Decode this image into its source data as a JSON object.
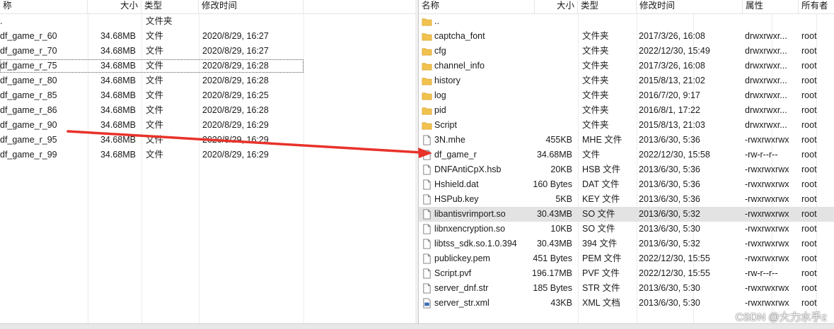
{
  "left": {
    "columns": {
      "name": "称",
      "size": "大小",
      "type": "类型",
      "modified": "修改时间"
    },
    "rows": [
      {
        "name": ".",
        "size": "",
        "type": "文件夹",
        "modified": ""
      },
      {
        "name": "df_game_r_60",
        "size": "34.68MB",
        "type": "文件",
        "modified": "2020/8/29, 16:27"
      },
      {
        "name": "df_game_r_70",
        "size": "34.68MB",
        "type": "文件",
        "modified": "2020/8/29, 16:27"
      },
      {
        "name": "df_game_r_75",
        "size": "34.68MB",
        "type": "文件",
        "modified": "2020/8/29, 16:28"
      },
      {
        "name": "df_game_r_80",
        "size": "34.68MB",
        "type": "文件",
        "modified": "2020/8/29, 16:28"
      },
      {
        "name": "df_game_r_85",
        "size": "34.68MB",
        "type": "文件",
        "modified": "2020/8/29, 16:25"
      },
      {
        "name": "df_game_r_86",
        "size": "34.68MB",
        "type": "文件",
        "modified": "2020/8/29, 16:28"
      },
      {
        "name": "df_game_r_90",
        "size": "34.68MB",
        "type": "文件",
        "modified": "2020/8/29, 16:29"
      },
      {
        "name": "df_game_r_95",
        "size": "34.68MB",
        "type": "文件",
        "modified": "2020/8/29, 16:29"
      },
      {
        "name": "df_game_r_99",
        "size": "34.68MB",
        "type": "文件",
        "modified": "2020/8/29, 16:29"
      }
    ]
  },
  "right": {
    "columns": {
      "name": "名称",
      "size": "大小",
      "type": "类型",
      "modified": "修改时间",
      "attrs": "属性",
      "owner": "所有者"
    },
    "rows": [
      {
        "icon": "folder-icon",
        "name": "..",
        "size": "",
        "type": "",
        "modified": "",
        "attrs": "",
        "owner": ""
      },
      {
        "icon": "folder-icon",
        "name": "captcha_font",
        "size": "",
        "type": "文件夹",
        "modified": "2017/3/26, 16:08",
        "attrs": "drwxrwxr...",
        "owner": "root"
      },
      {
        "icon": "folder-icon",
        "name": "cfg",
        "size": "",
        "type": "文件夹",
        "modified": "2022/12/30, 15:49",
        "attrs": "drwxrwxr...",
        "owner": "root"
      },
      {
        "icon": "folder-icon",
        "name": "channel_info",
        "size": "",
        "type": "文件夹",
        "modified": "2017/3/26, 16:08",
        "attrs": "drwxrwxr...",
        "owner": "root"
      },
      {
        "icon": "folder-icon",
        "name": "history",
        "size": "",
        "type": "文件夹",
        "modified": "2015/8/13, 21:02",
        "attrs": "drwxrwxr...",
        "owner": "root"
      },
      {
        "icon": "folder-icon",
        "name": "log",
        "size": "",
        "type": "文件夹",
        "modified": "2016/7/20, 9:17",
        "attrs": "drwxrwxr...",
        "owner": "root"
      },
      {
        "icon": "folder-icon",
        "name": "pid",
        "size": "",
        "type": "文件夹",
        "modified": "2016/8/1, 17:22",
        "attrs": "drwxrwxr...",
        "owner": "root"
      },
      {
        "icon": "folder-icon",
        "name": "Script",
        "size": "",
        "type": "文件夹",
        "modified": "2015/8/13, 21:03",
        "attrs": "drwxrwxr...",
        "owner": "root"
      },
      {
        "icon": "file-icon",
        "name": "3N.mhe",
        "size": "455KB",
        "type": "MHE 文件",
        "modified": "2013/6/30, 5:36",
        "attrs": "-rwxrwxrwx",
        "owner": "root"
      },
      {
        "icon": "file-icon",
        "name": "df_game_r",
        "size": "34.68MB",
        "type": "文件",
        "modified": "2022/12/30, 15:58",
        "attrs": "-rw-r--r--",
        "owner": "root"
      },
      {
        "icon": "file-icon",
        "name": "DNFAntiCpX.hsb",
        "size": "20KB",
        "type": "HSB 文件",
        "modified": "2013/6/30, 5:36",
        "attrs": "-rwxrwxrwx",
        "owner": "root"
      },
      {
        "icon": "file-icon",
        "name": "Hshield.dat",
        "size": "160 Bytes",
        "type": "DAT 文件",
        "modified": "2013/6/30, 5:36",
        "attrs": "-rwxrwxrwx",
        "owner": "root"
      },
      {
        "icon": "file-icon",
        "name": "HSPub.key",
        "size": "5KB",
        "type": "KEY 文件",
        "modified": "2013/6/30, 5:36",
        "attrs": "-rwxrwxrwx",
        "owner": "root"
      },
      {
        "icon": "file-icon",
        "name": "libantisvrimport.so",
        "size": "30.43MB",
        "type": "SO 文件",
        "modified": "2013/6/30, 5:32",
        "attrs": "-rwxrwxrwx",
        "owner": "root"
      },
      {
        "icon": "file-icon",
        "name": "libnxencryption.so",
        "size": "10KB",
        "type": "SO 文件",
        "modified": "2013/6/30, 5:30",
        "attrs": "-rwxrwxrwx",
        "owner": "root"
      },
      {
        "icon": "file-icon",
        "name": "libtss_sdk.so.1.0.394",
        "size": "30.43MB",
        "type": "394 文件",
        "modified": "2013/6/30, 5:32",
        "attrs": "-rwxrwxrwx",
        "owner": "root"
      },
      {
        "icon": "file-icon",
        "name": "publickey.pem",
        "size": "451 Bytes",
        "type": "PEM 文件",
        "modified": "2022/12/30, 15:55",
        "attrs": "-rwxrwxrwx",
        "owner": "root"
      },
      {
        "icon": "file-icon",
        "name": "Script.pvf",
        "size": "196.17MB",
        "type": "PVF 文件",
        "modified": "2022/12/30, 15:55",
        "attrs": "-rw-r--r--",
        "owner": "root"
      },
      {
        "icon": "file-icon",
        "name": "server_dnf.str",
        "size": "185 Bytes",
        "type": "STR 文件",
        "modified": "2013/6/30, 5:30",
        "attrs": "-rwxrwxrwx",
        "owner": "root"
      },
      {
        "icon": "xml-file-icon",
        "name": "server_str.xml",
        "size": "43KB",
        "type": "XML 文档",
        "modified": "2013/6/30, 5:30",
        "attrs": "-rwxrwxrwx",
        "owner": "root"
      }
    ]
  },
  "colors": {
    "folder": "#f2c24f",
    "arrow": "#e8322b",
    "selected_row": "#e3e3e3"
  },
  "watermark": "CSDN @大力水手z"
}
